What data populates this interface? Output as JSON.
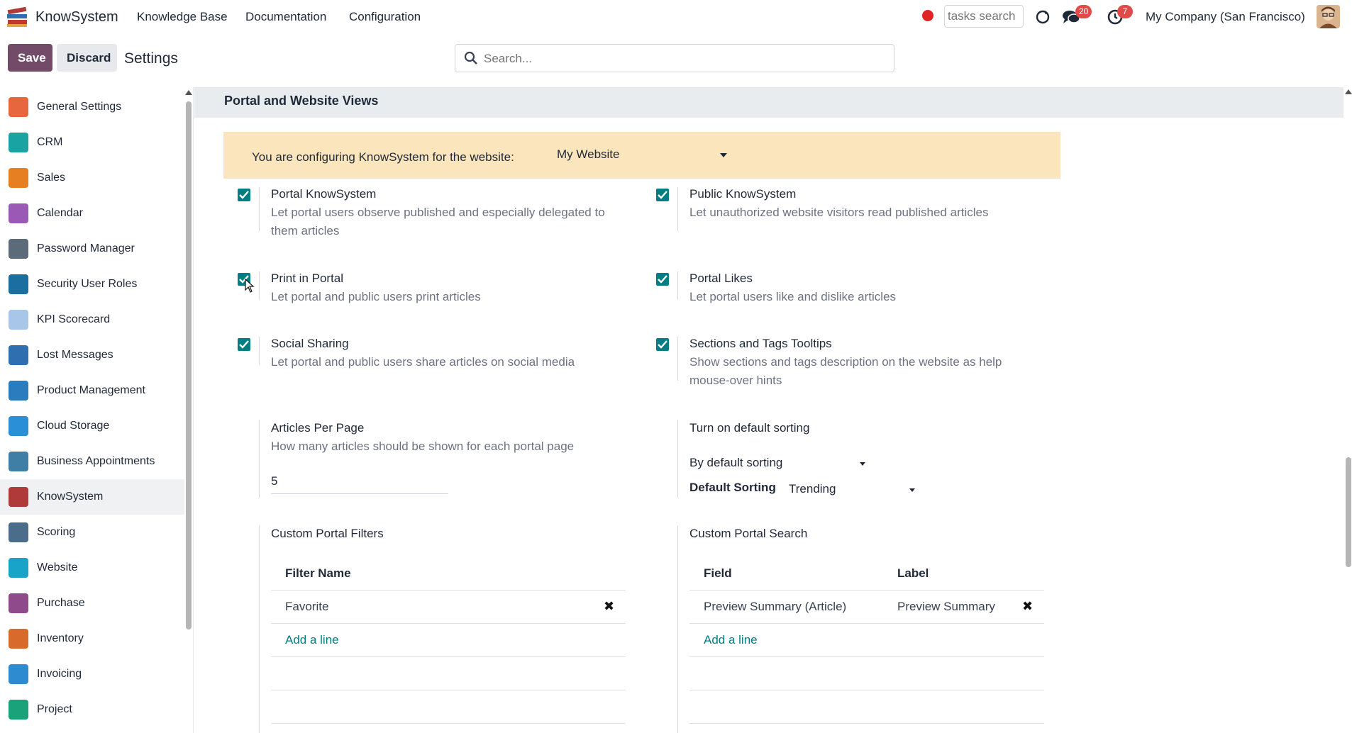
{
  "navbar": {
    "app_name": "KnowSystem",
    "menus": [
      "Knowledge Base",
      "Documentation",
      "Configuration"
    ],
    "tasks_search_placeholder": "tasks search",
    "messages_count": "20",
    "activities_count": "7",
    "company": "My Company (San Francisco)"
  },
  "control": {
    "save_label": "Save",
    "discard_label": "Discard",
    "title": "Settings",
    "search_placeholder": "Search..."
  },
  "sidebar": {
    "items": [
      {
        "label": "General Settings",
        "icon": "general-settings-icon",
        "color": "#e8663d"
      },
      {
        "label": "CRM",
        "icon": "crm-icon",
        "color": "#1aa3a3"
      },
      {
        "label": "Sales",
        "icon": "sales-icon",
        "color": "#e67e22"
      },
      {
        "label": "Calendar",
        "icon": "calendar-icon",
        "color": "#9b59b6"
      },
      {
        "label": "Password Manager",
        "icon": "password-manager-icon",
        "color": "#5b6b7a"
      },
      {
        "label": "Security User Roles",
        "icon": "security-roles-icon",
        "color": "#1a6ea0"
      },
      {
        "label": "KPI Scorecard",
        "icon": "kpi-scorecard-icon",
        "color": "#a7c6e8"
      },
      {
        "label": "Lost Messages",
        "icon": "lost-messages-icon",
        "color": "#2f6fb0"
      },
      {
        "label": "Product Management",
        "icon": "product-management-icon",
        "color": "#2b7bbf"
      },
      {
        "label": "Cloud Storage",
        "icon": "cloud-storage-icon",
        "color": "#2a8fd6"
      },
      {
        "label": "Business Appointments",
        "icon": "business-appointments-icon",
        "color": "#3f7fa6"
      },
      {
        "label": "KnowSystem",
        "icon": "knowsystem-icon",
        "color": "#b03a3a"
      },
      {
        "label": "Scoring",
        "icon": "scoring-icon",
        "color": "#4b6c8a"
      },
      {
        "label": "Website",
        "icon": "website-icon",
        "color": "#1aa3c9"
      },
      {
        "label": "Purchase",
        "icon": "purchase-icon",
        "color": "#8e4a8a"
      },
      {
        "label": "Inventory",
        "icon": "inventory-icon",
        "color": "#d86b2b"
      },
      {
        "label": "Invoicing",
        "icon": "invoicing-icon",
        "color": "#2e8bd0"
      },
      {
        "label": "Project",
        "icon": "project-icon",
        "color": "#1aa37a"
      }
    ],
    "active": "KnowSystem"
  },
  "section": {
    "title": "Portal and Website Views",
    "banner_label": "You are configuring KnowSystem for the website:",
    "website_value": "My Website"
  },
  "settings": {
    "portal_knowsystem": {
      "title": "Portal KnowSystem",
      "desc": "Let portal users observe published and especially delegated to them articles",
      "checked": true
    },
    "public_knowsystem": {
      "title": "Public KnowSystem",
      "desc": "Let unauthorized website visitors read published articles",
      "checked": true
    },
    "print_in_portal": {
      "title": "Print in Portal",
      "desc": "Let portal and public users print articles",
      "checked": true
    },
    "portal_likes": {
      "title": "Portal Likes",
      "desc": "Let portal users like and dislike articles",
      "checked": true
    },
    "social_sharing": {
      "title": "Social Sharing",
      "desc": "Let portal and public users share articles on social media",
      "checked": true
    },
    "sections_tooltips": {
      "title": "Sections and Tags Tooltips",
      "desc": "Show sections and tags description on the website as help mouse-over hints",
      "checked": true
    },
    "articles_per_page": {
      "title": "Articles Per Page",
      "desc": "How many articles should be shown for each portal page",
      "value": "5"
    },
    "default_sorting": {
      "title": "Turn on default sorting",
      "select_value": "By default sorting",
      "label": "Default Sorting",
      "sorting_value": "Trending"
    }
  },
  "filters": {
    "title": "Custom Portal Filters",
    "column": "Filter Name",
    "rows": [
      "Favorite"
    ],
    "add_label": "Add a line"
  },
  "search": {
    "title": "Custom Portal Search",
    "columns": [
      "Field",
      "Label"
    ],
    "rows": [
      {
        "field": "Preview Summary (Article)",
        "label": "Preview Summary"
      }
    ],
    "add_label": "Add a line"
  },
  "colors": {
    "primary": "#714b67",
    "accent": "#017e84",
    "banner": "#fbe5bd"
  }
}
